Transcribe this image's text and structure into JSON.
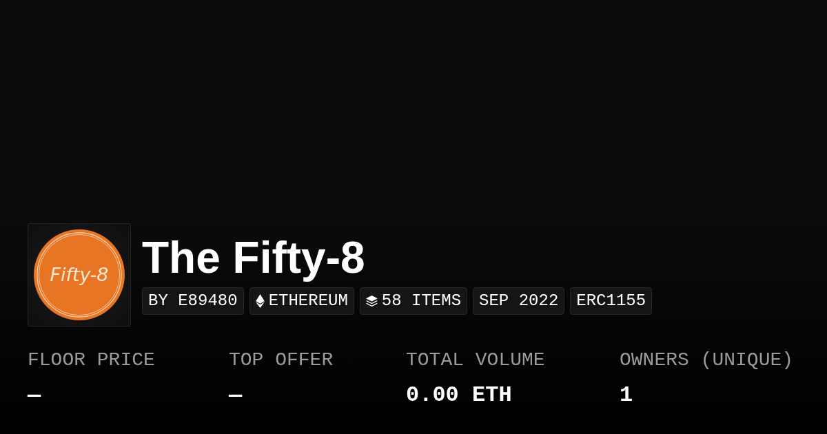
{
  "collection": {
    "logo_text": "Fifty-8",
    "title": "The Fifty-8",
    "tags": [
      {
        "kind": "text",
        "label": "BY E89480"
      },
      {
        "kind": "chain",
        "label": "ETHEREUM"
      },
      {
        "kind": "items",
        "label": "58 ITEMS"
      },
      {
        "kind": "text",
        "label": "SEP 2022"
      },
      {
        "kind": "text",
        "label": "ERC1155"
      }
    ]
  },
  "stats": [
    {
      "label": "FLOOR PRICE",
      "value": "—"
    },
    {
      "label": "TOP OFFER",
      "value": "—"
    },
    {
      "label": "TOTAL VOLUME",
      "value": "0.00 ETH"
    },
    {
      "label": "OWNERS (UNIQUE)",
      "value": "1"
    }
  ]
}
